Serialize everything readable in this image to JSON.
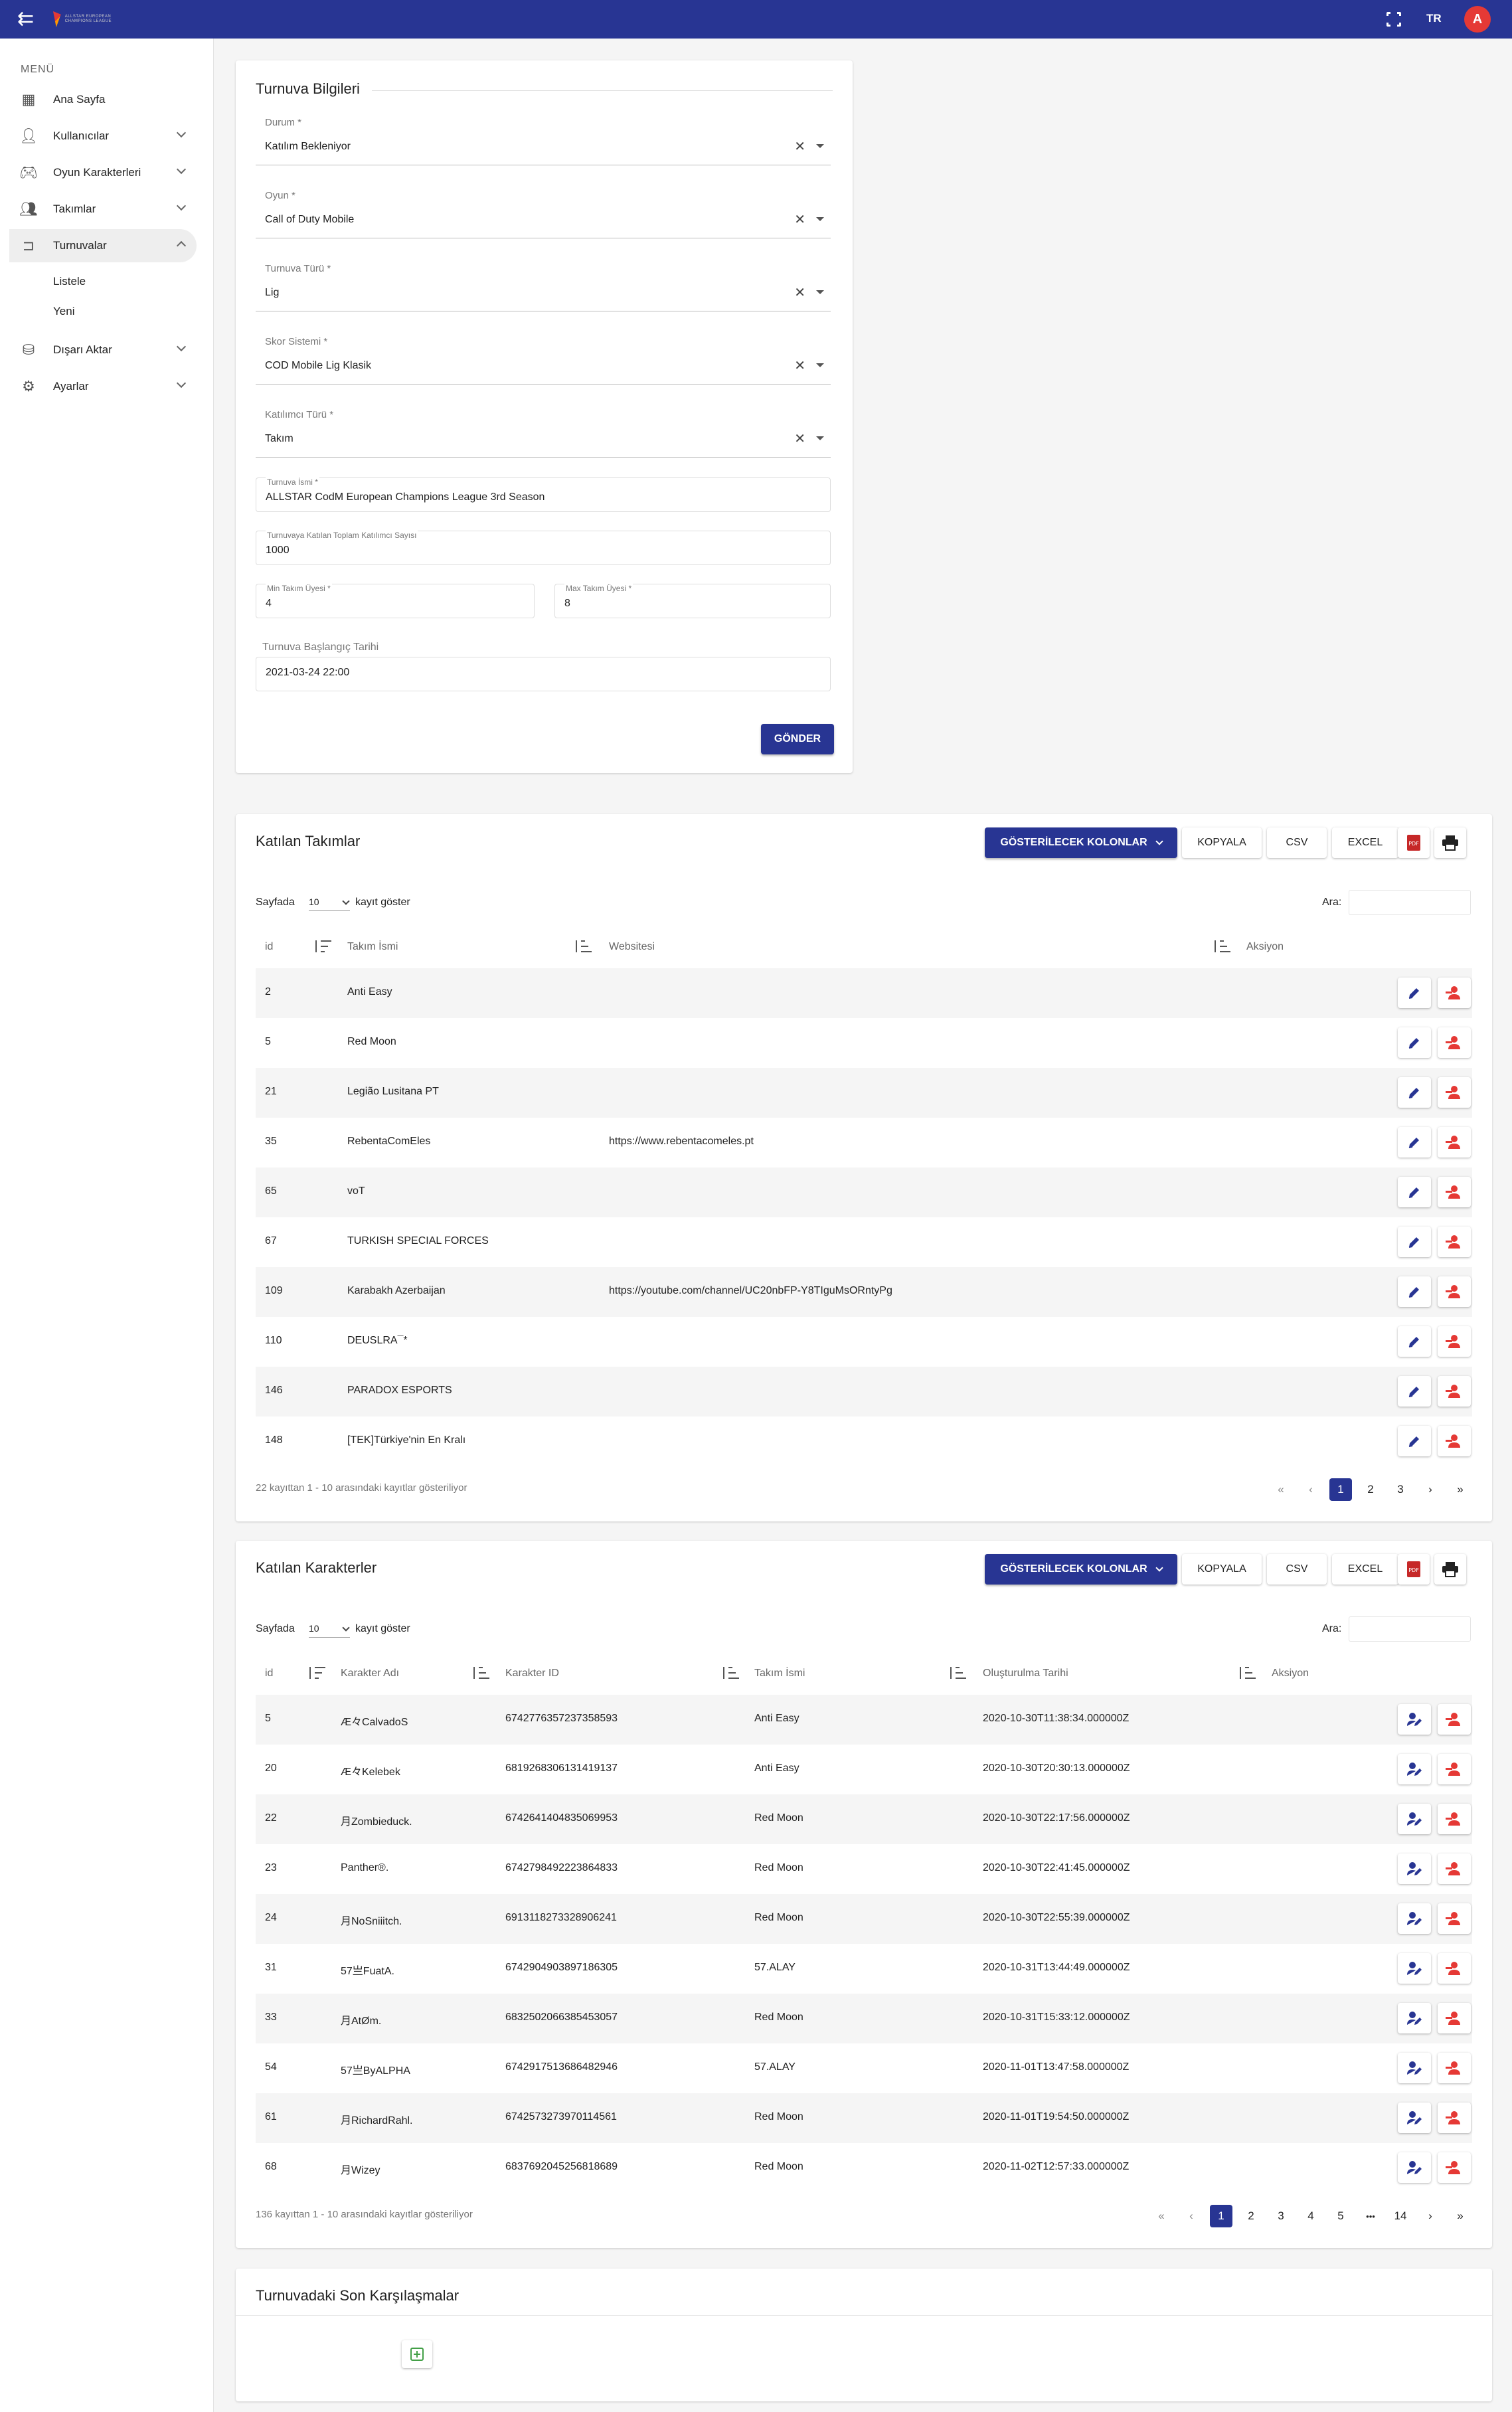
{
  "topbar": {
    "lang": "TR",
    "avatar": "A",
    "logo_text": "ALLSTAR EUROPEAN CHAMPIONS LEAGUE"
  },
  "sidebar": {
    "menu_title": "MENÜ",
    "items": [
      {
        "label": "Ana Sayfa",
        "icon": "dashboard-icon"
      },
      {
        "label": "Kullanıcılar",
        "icon": "person-icon"
      },
      {
        "label": "Oyun Karakterleri",
        "icon": "gamepad-icon"
      },
      {
        "label": "Takımlar",
        "icon": "group-icon"
      },
      {
        "label": "Turnuvalar",
        "icon": "tournament-icon"
      },
      {
        "label": "Dışarı Aktar",
        "icon": "database-export-icon"
      },
      {
        "label": "Ayarlar",
        "icon": "gear-icon"
      }
    ],
    "sub_items": [
      "Listele",
      "Yeni"
    ]
  },
  "form": {
    "title": "Turnuva Bilgileri",
    "fields": [
      {
        "label": "Durum *",
        "value": "Katılım Bekleniyor"
      },
      {
        "label": "Oyun *",
        "value": "Call of Duty Mobile"
      },
      {
        "label": "Turnuva Türü *",
        "value": "Lig"
      },
      {
        "label": "Skor Sistemi *",
        "value": "COD Mobile Lig Klasik"
      },
      {
        "label": "Katılımcı Türü *",
        "value": "Takım"
      }
    ],
    "name_label": "Turnuva İsmi *",
    "name_value": "ALLSTAR CodM European Champions League 3rd Season",
    "total_label": "Turnuvaya Katılan Toplam Katılımcı Sayısı",
    "total_value": "1000",
    "min_label": "Min Takım Üyesi *",
    "min_value": "4",
    "max_label": "Max Takım Üyesi *",
    "max_value": "8",
    "start_label": "Turnuva Başlangıç Tarihi",
    "start_value": "2021-03-24 22:00",
    "submit": "GÖNDER"
  },
  "toolbar": {
    "columns": "GÖSTERİLECEK KOLONLAR",
    "copy": "KOPYALA",
    "csv": "CSV",
    "excel": "EXCEL"
  },
  "common": {
    "sayfa": "Sayfada",
    "kayit": "kayıt göster",
    "ara": "Ara:",
    "per_page": "10"
  },
  "teams": {
    "title": "Katılan Takımlar",
    "headers": [
      "id",
      "Takım İsmi",
      "Websitesi",
      "Aksiyon"
    ],
    "rows": [
      [
        "2",
        "Anti Easy",
        ""
      ],
      [
        "5",
        "Red Moon",
        ""
      ],
      [
        "21",
        "Legião Lusitana PT",
        ""
      ],
      [
        "35",
        "RebentaComEles",
        "https://www.rebentacomeles.pt"
      ],
      [
        "65",
        "voT",
        ""
      ],
      [
        "67",
        "TURKISH SPECIAL FORCES",
        ""
      ],
      [
        "109",
        "Karabakh Azerbaijan",
        "https://youtube.com/channel/UC20nbFP-Y8TIguMsORntyPg"
      ],
      [
        "110",
        "DEUSLRA¯*",
        ""
      ],
      [
        "146",
        "PARADOX ESPORTS",
        ""
      ],
      [
        "148",
        "[TEK]Türkiye'nin En Kralı",
        ""
      ]
    ],
    "info": "22 kayıttan 1 - 10 arasındaki kayıtlar gösteriliyor",
    "pages": [
      "1",
      "2",
      "3"
    ]
  },
  "chars": {
    "title": "Katılan Karakterler",
    "headers": [
      "id",
      "Karakter Adı",
      "Karakter ID",
      "Takım İsmi",
      "Oluşturulma Tarihi",
      "Aksiyon"
    ],
    "rows": [
      [
        "5",
        "Æ々CalvadoS",
        "6742776357237358593",
        "Anti Easy",
        "2020-10-30T11:38:34.000000Z"
      ],
      [
        "20",
        "Æ々Kelebek",
        "6819268306131419137",
        "Anti Easy",
        "2020-10-30T20:30:13.000000Z"
      ],
      [
        "22",
        "月Zombieduck.",
        "6742641404835069953",
        "Red Moon",
        "2020-10-30T22:17:56.000000Z"
      ],
      [
        "23",
        "Panther®.",
        "6742798492223864833",
        "Red Moon",
        "2020-10-30T22:41:45.000000Z"
      ],
      [
        "24",
        "月NoSniiitch.",
        "6913118273328906241",
        "Red Moon",
        "2020-10-30T22:55:39.000000Z"
      ],
      [
        "31",
        "57亗FuatA.",
        "6742904903897186305",
        "57.ALAY",
        "2020-10-31T13:44:49.000000Z"
      ],
      [
        "33",
        "月AtØm.",
        "6832502066385453057",
        "Red Moon",
        "2020-10-31T15:33:12.000000Z"
      ],
      [
        "54",
        "57亗ByALPHA",
        "6742917513686482946",
        "57.ALAY",
        "2020-11-01T13:47:58.000000Z"
      ],
      [
        "61",
        "月RichardRahl.",
        "6742573273970114561",
        "Red Moon",
        "2020-11-01T19:54:50.000000Z"
      ],
      [
        "68",
        "月Wizey",
        "6837692045256818689",
        "Red Moon",
        "2020-11-02T12:57:33.000000Z"
      ]
    ],
    "info": "136 kayıttan 1 - 10 arasındaki kayıtlar gösteriliyor",
    "pages": [
      "1",
      "2",
      "3",
      "4",
      "5",
      "•••",
      "14"
    ]
  },
  "matches": {
    "title": "Turnuvadaki Son Karşılaşmalar"
  },
  "colors": {
    "primary": "#283593",
    "danger": "#e53935"
  }
}
